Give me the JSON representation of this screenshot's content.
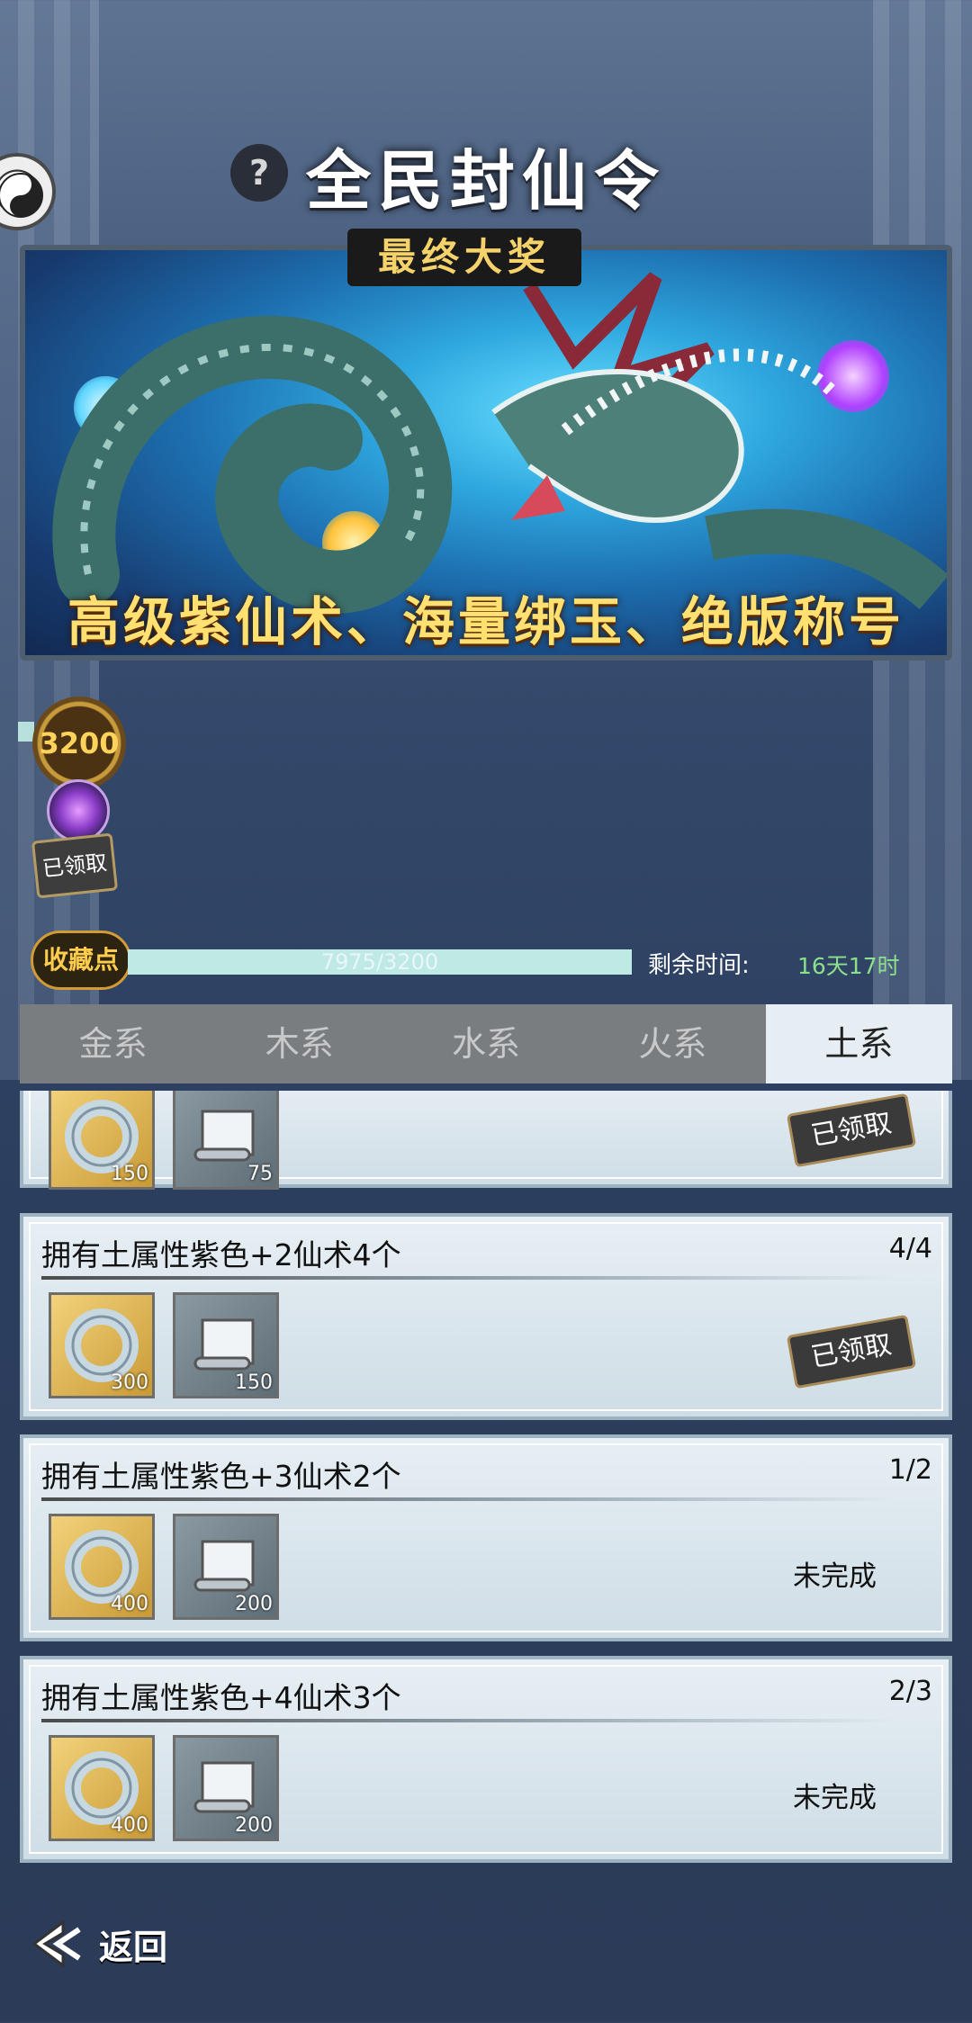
{
  "header": {
    "title": "全民封仙令",
    "help": "?"
  },
  "banner": {
    "tag": "最终大奖",
    "caption": "高级紫仙术、海量绑玉、绝版称号"
  },
  "reward": {
    "points": "3200",
    "claimed_label": "已领取"
  },
  "progress": {
    "badge": "收藏点",
    "text": "7975/3200",
    "fraction": 1.0,
    "remain_label": "剩余时间:",
    "remain_value": "16天17时"
  },
  "tabs": [
    {
      "label": "金系"
    },
    {
      "label": "木系"
    },
    {
      "label": "水系"
    },
    {
      "label": "火系"
    },
    {
      "label": "土系",
      "active": true
    }
  ],
  "tasks": [
    {
      "title": "",
      "count": "",
      "rewards": [
        "150",
        "75"
      ],
      "status": "已领取"
    },
    {
      "title": "拥有土属性紫色+2仙术4个",
      "count": "4/4",
      "rewards": [
        "300",
        "150"
      ],
      "status": "已领取"
    },
    {
      "title": "拥有土属性紫色+3仙术2个",
      "count": "1/2",
      "rewards": [
        "400",
        "200"
      ],
      "status": "未完成"
    },
    {
      "title": "拥有土属性紫色+4仙术3个",
      "count": "2/3",
      "rewards": [
        "400",
        "200"
      ],
      "status": "未完成"
    }
  ],
  "footer": {
    "back_label": "返回"
  }
}
